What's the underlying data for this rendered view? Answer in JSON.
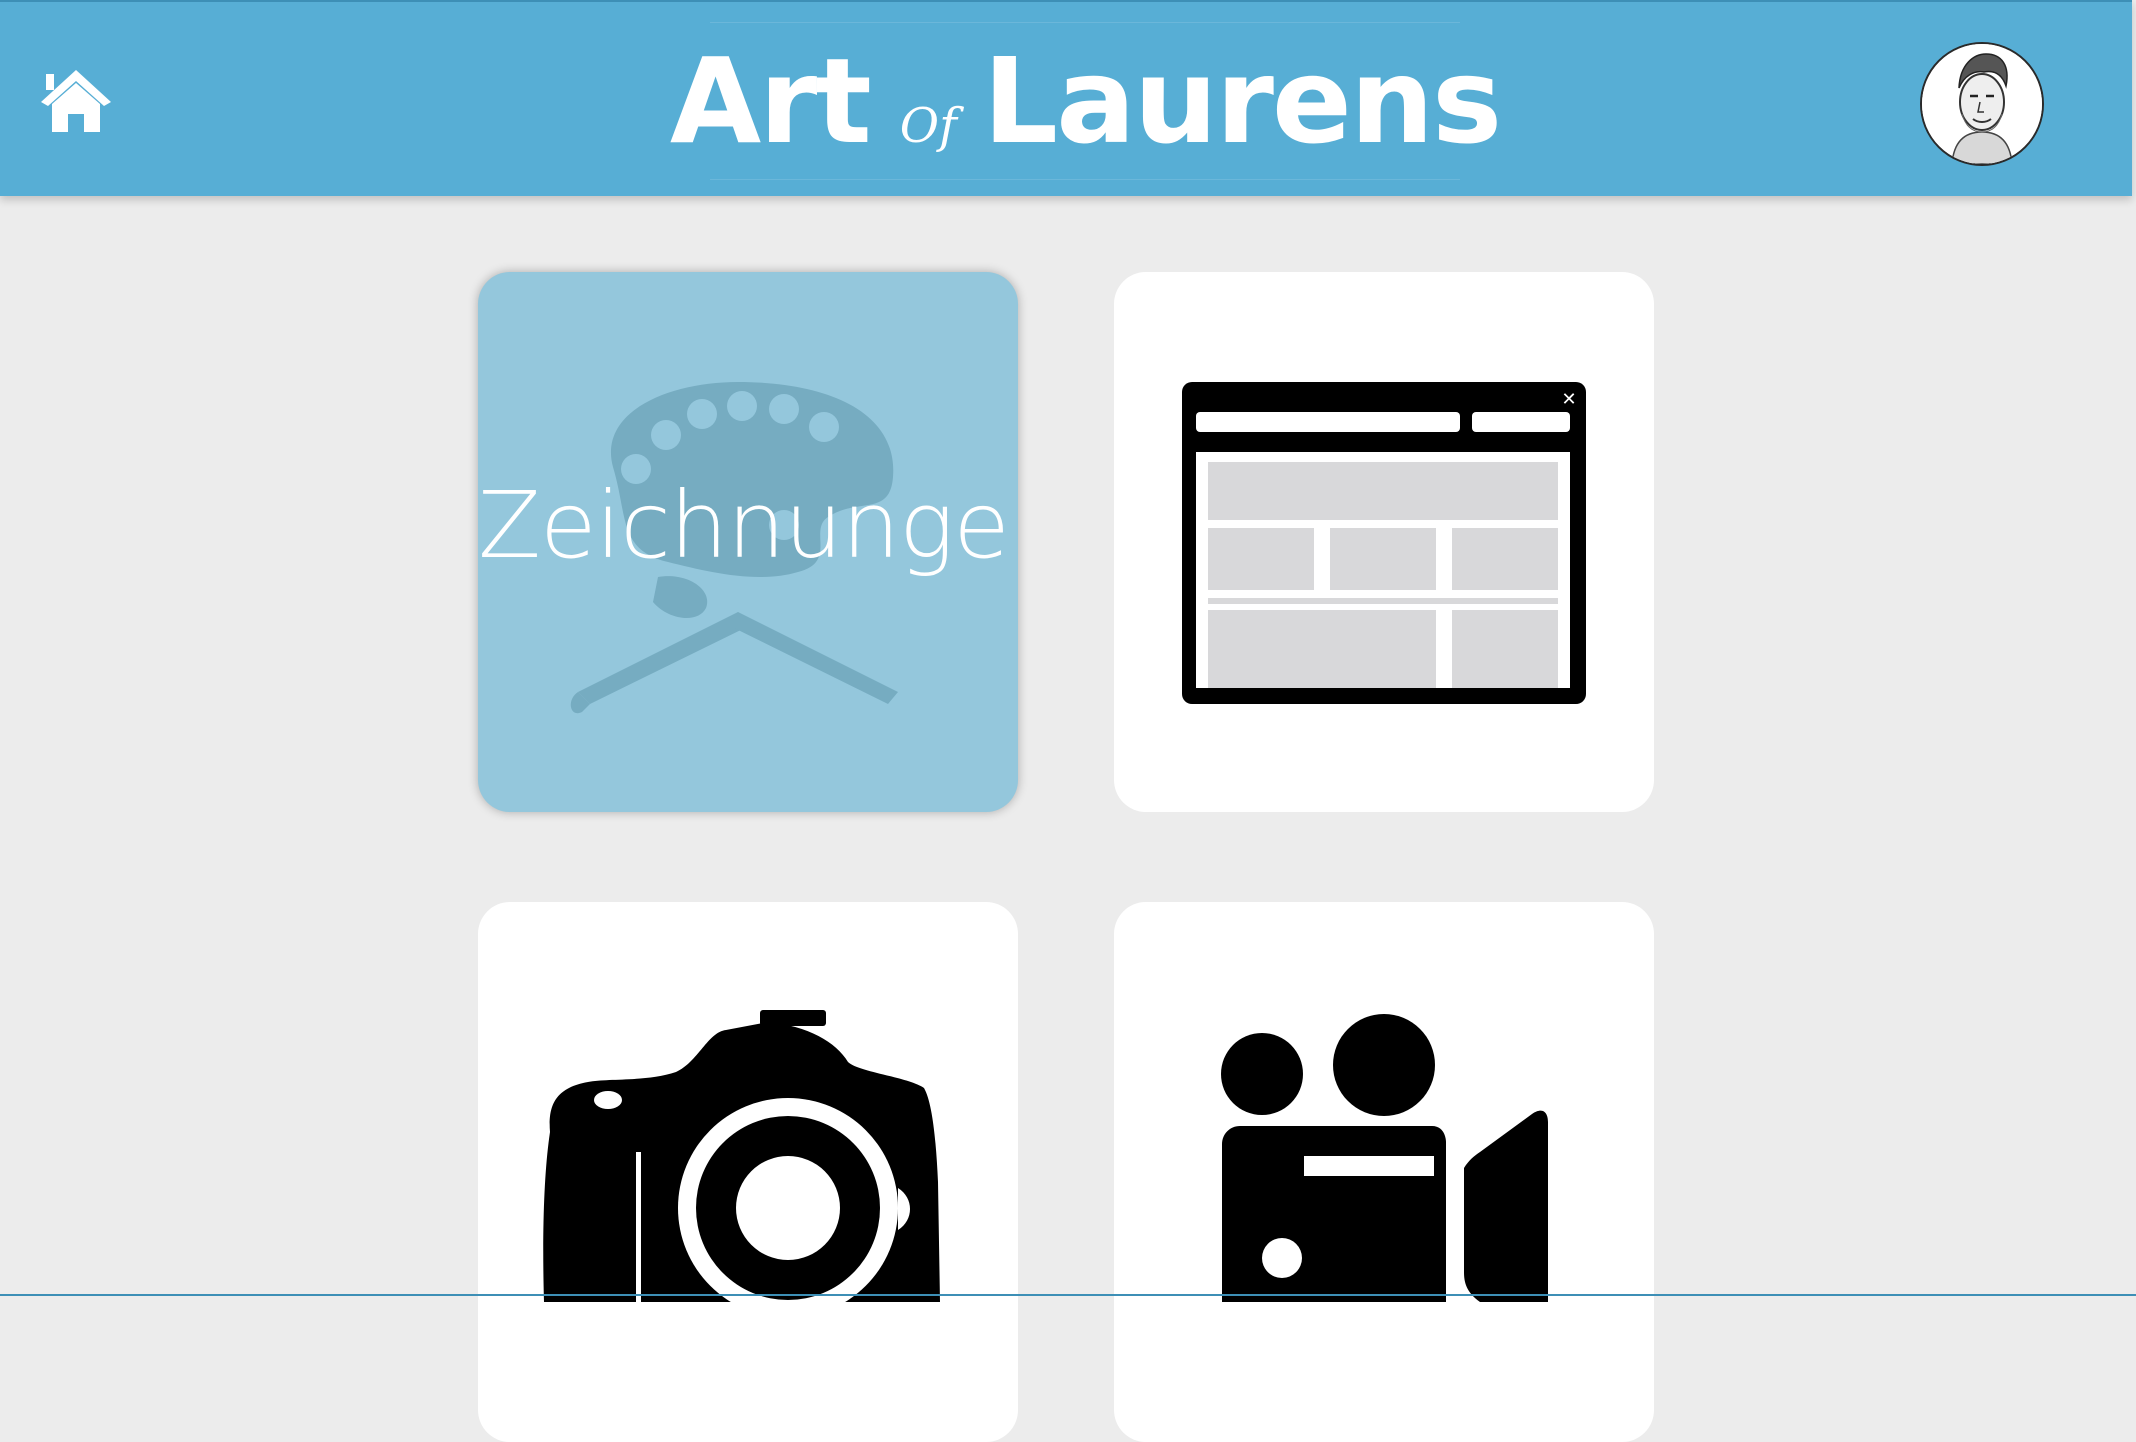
{
  "header": {
    "logo_part1": "Art",
    "logo_part2": "Of",
    "logo_part3": "Laurens",
    "background_color": "#57aed5"
  },
  "tiles": [
    {
      "label": "Zeichnungen",
      "icon": "palette-brushes-icon",
      "state": "hover"
    },
    {
      "label": "",
      "icon": "browser-window-icon"
    },
    {
      "label": "",
      "icon": "camera-icon"
    },
    {
      "label": "",
      "icon": "video-camera-icon"
    }
  ]
}
